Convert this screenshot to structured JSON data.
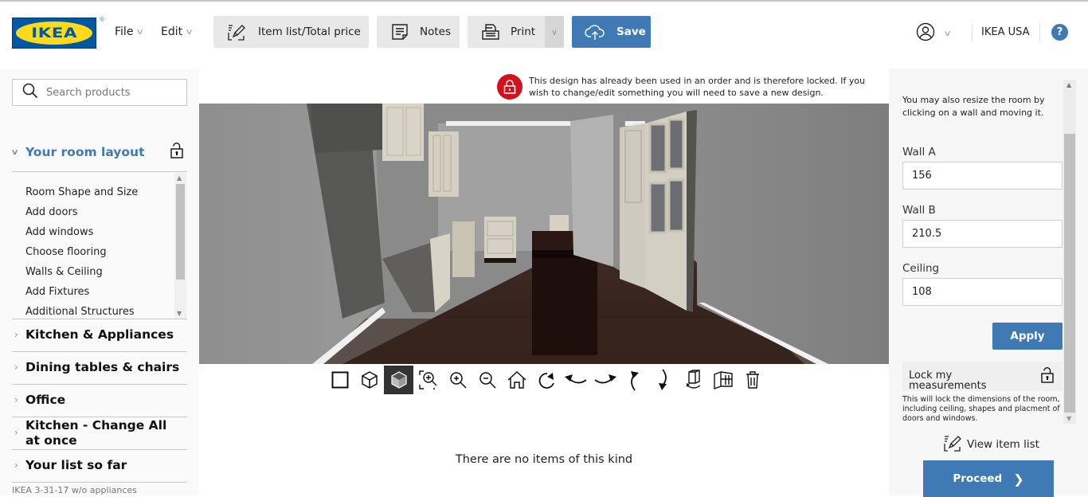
{
  "header": {
    "logo_text": "IKEA",
    "logo_reg": "®",
    "menus": [
      {
        "label": "File"
      },
      {
        "label": "Edit"
      }
    ],
    "toolbar": {
      "item_list_label": "Item list/Total price",
      "notes_label": "Notes",
      "print_label": "Print",
      "save_label": "Save"
    },
    "country": "IKEA USA",
    "help_label": "?",
    "colors": {
      "accent": "#3f7ab4",
      "logo_blue": "#0058a3",
      "logo_yellow": "#ffda1a",
      "lock_red": "#d3101c"
    }
  },
  "sidebar": {
    "search_placeholder": "Search products",
    "room_layout": {
      "title": "Your room layout",
      "items": [
        "Room Shape and Size",
        "Add doors",
        "Add windows",
        "Choose flooring",
        "Walls & Ceiling",
        "Add Fixtures",
        "Additional Structures"
      ]
    },
    "categories": [
      "Kitchen & Appliances",
      "Dining tables & chairs",
      "Office",
      "Kitchen - Change All at once",
      "Your list so far"
    ],
    "design_name": "IKEA 3-31-17 w/o appliances"
  },
  "center": {
    "notice": "This design has already been used in an order and is therefore locked. If you wish to change/edit something you will need to save a new design.",
    "view_tools": [
      {
        "name": "2d-view-icon"
      },
      {
        "name": "3d-view-icon"
      },
      {
        "name": "3d-solid-view-icon",
        "active": true
      },
      {
        "name": "zoom-fit-icon"
      },
      {
        "name": "zoom-in-icon"
      },
      {
        "name": "zoom-out-icon"
      },
      {
        "name": "home-view-icon"
      },
      {
        "name": "rotate-icon"
      },
      {
        "name": "turn-left-icon"
      },
      {
        "name": "turn-right-icon"
      },
      {
        "name": "tilt-up-icon"
      },
      {
        "name": "tilt-down-icon"
      },
      {
        "name": "rotate-object-icon"
      },
      {
        "name": "walls-icon"
      },
      {
        "name": "trash-icon"
      }
    ],
    "empty_message": "There are no items of this kind"
  },
  "right": {
    "hint": "You may also resize the room by clicking on a wall and moving it.",
    "fields": [
      {
        "label": "Wall A",
        "value": "156"
      },
      {
        "label": "Wall B",
        "value": "210.5"
      },
      {
        "label": "Ceiling",
        "value": "108"
      }
    ],
    "apply_label": "Apply",
    "lock_label": "Lock my measurements",
    "lock_desc": "This will lock the dimensions of the room, including ceiling, shapes and placment of doors and windows.",
    "view_item_list": "View item list",
    "proceed_label": "Proceed"
  }
}
